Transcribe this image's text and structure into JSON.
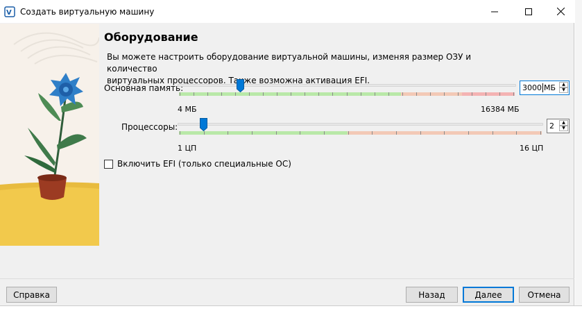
{
  "window": {
    "title": "Создать виртуальную машину"
  },
  "page": {
    "heading": "Оборудование",
    "description_line1": "Вы можете настроить оборудование виртуальной машины, изменяя размер ОЗУ и количество",
    "description_line2": "виртуальных процессоров. Также возможна активация EFI."
  },
  "memory": {
    "label": "Основная память:",
    "value": "3000",
    "unit": "МБ",
    "min_label": "4 МБ",
    "max_label": "16384 МБ",
    "value_fraction": 0.18
  },
  "cpu": {
    "label": "Процессоры:",
    "value": "2",
    "min_label": "1 ЦП",
    "max_label": "16 ЦП",
    "value_fraction": 0.067
  },
  "efi": {
    "label": "Включить EFI (только специальные ОС)",
    "checked": false
  },
  "buttons": {
    "help": "Справка",
    "back": "Назад",
    "next": "Далее",
    "cancel": "Отмена"
  },
  "colors": {
    "slider_ok": "#b9e8a8",
    "slider_warn": "#f3c9b6",
    "slider_bad": "#f4b3b3",
    "thumb": "#0078d7",
    "accent": "#0078d7"
  }
}
